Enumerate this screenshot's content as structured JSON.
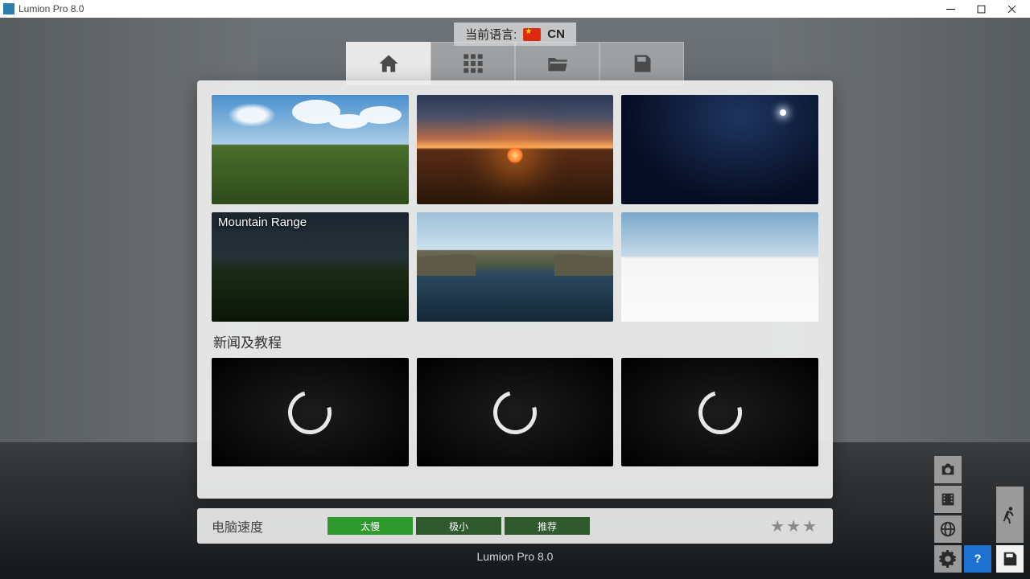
{
  "app": {
    "title": "Lumion Pro 8.0",
    "footer": "Lumion Pro 8.0"
  },
  "language": {
    "label": "当前语言:",
    "code": "CN"
  },
  "tabs": {
    "home": "home",
    "grid": "grid",
    "open": "open",
    "save": "save"
  },
  "scenes": [
    {
      "key": "day",
      "label": ""
    },
    {
      "key": "sunset",
      "label": ""
    },
    {
      "key": "night",
      "label": ""
    },
    {
      "key": "dark",
      "label": "Mountain Range"
    },
    {
      "key": "fjord",
      "label": ""
    },
    {
      "key": "white",
      "label": ""
    }
  ],
  "news": {
    "title": "新闻及教程"
  },
  "speed": {
    "label": "电脑速度",
    "segments": [
      {
        "text": "太慢",
        "style": "bright"
      },
      {
        "text": "极小",
        "style": "dim"
      },
      {
        "text": "推荐",
        "style": "dim"
      }
    ],
    "stars": "★★★"
  },
  "side": {
    "camera": "camera",
    "film": "film",
    "globe": "globe",
    "walk": "walk",
    "save": "save",
    "gear": "gear",
    "help": "?"
  }
}
